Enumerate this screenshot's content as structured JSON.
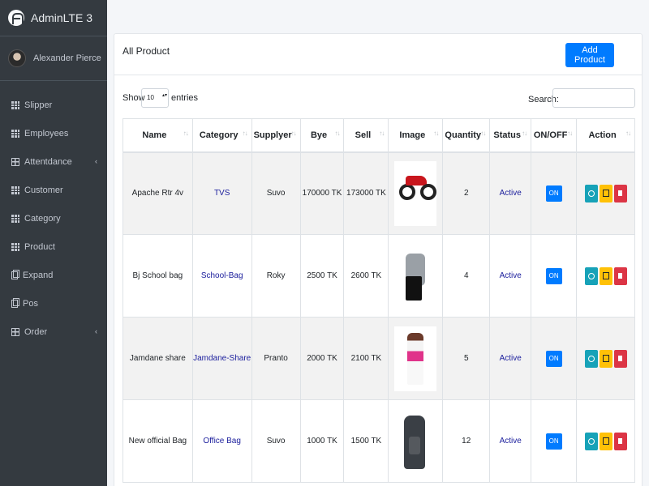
{
  "brand": {
    "title": "AdminLTE 3"
  },
  "user": {
    "name": "Alexander Pierce"
  },
  "sidebar": {
    "items": [
      {
        "label": "Slipper",
        "icon": "grid-icon"
      },
      {
        "label": "Employees",
        "icon": "grid-icon"
      },
      {
        "label": "Attentdance",
        "icon": "table-icon",
        "chevron": "‹"
      },
      {
        "label": "Customer",
        "icon": "grid-icon"
      },
      {
        "label": "Category",
        "icon": "grid-icon"
      },
      {
        "label": "Product",
        "icon": "grid-icon"
      },
      {
        "label": "Expand",
        "icon": "copy-icon"
      },
      {
        "label": "Pos",
        "icon": "copy-icon"
      },
      {
        "label": "Order",
        "icon": "table-icon",
        "chevron": "‹"
      }
    ]
  },
  "card": {
    "title": "All Product",
    "add_label": "Add Product"
  },
  "controls": {
    "show_label": "Show",
    "entries_value": "10",
    "entries_label": "entries",
    "search_label": "Search:"
  },
  "table": {
    "headers": [
      "Name",
      "Category",
      "Supplyer",
      "Bye",
      "Sell",
      "Image",
      "Quantity",
      "Status",
      "ON/OFF",
      "Action"
    ],
    "rows": [
      {
        "name": "Apache Rtr 4v",
        "category": "TVS",
        "supplier": "Suvo",
        "buy": "170000 TK",
        "sell": "173000 TK",
        "image": "motorbike",
        "quantity": "2",
        "status": "Active",
        "toggle": "ON"
      },
      {
        "name": "Bj School bag",
        "category": "School-Bag",
        "supplier": "Roky",
        "buy": "2500 TK",
        "sell": "2600 TK",
        "image": "school-bag",
        "quantity": "4",
        "status": "Active",
        "toggle": "ON"
      },
      {
        "name": "Jamdane share",
        "category": "Jamdane-Share",
        "supplier": "Pranto",
        "buy": "2000 TK",
        "sell": "2100 TK",
        "image": "saree",
        "quantity": "5",
        "status": "Active",
        "toggle": "ON"
      },
      {
        "name": "New official Bag",
        "category": "Office Bag",
        "supplier": "Suvo",
        "buy": "1000 TK",
        "sell": "1500 TK",
        "image": "office-bag",
        "quantity": "12",
        "status": "Active",
        "toggle": "ON"
      }
    ]
  },
  "colors": {
    "sidebar_bg": "#343a40",
    "primary": "#007bff",
    "info": "#17a2b8",
    "warning": "#ffc107",
    "danger": "#dc3545",
    "link": "#1a1d9c"
  }
}
